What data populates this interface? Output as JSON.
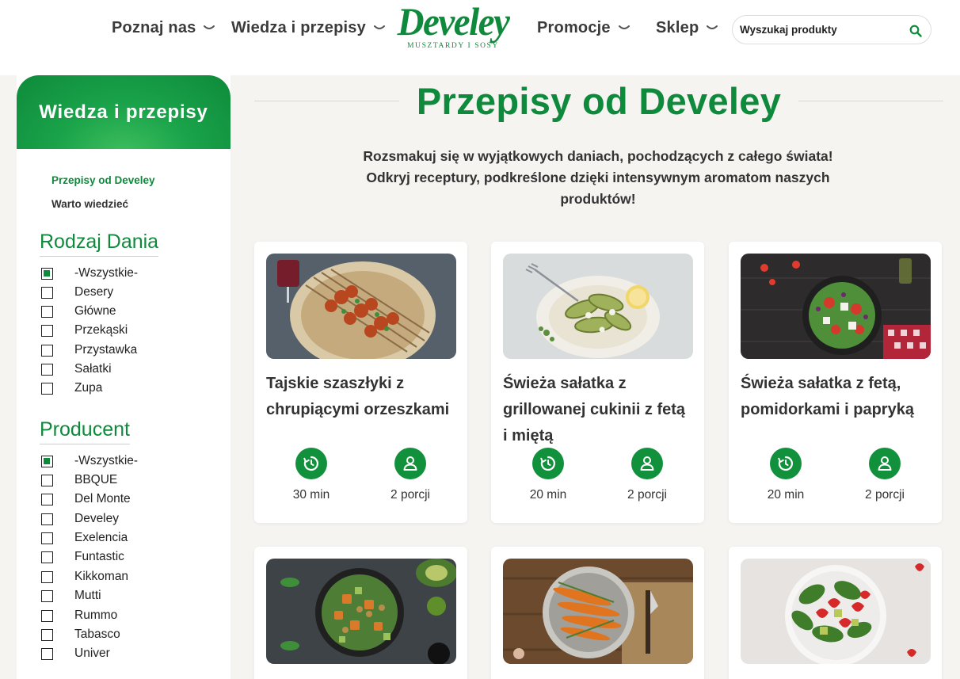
{
  "header": {
    "nav": [
      {
        "label": "Poznaj nas"
      },
      {
        "label": "Wiedza i przepisy"
      },
      {
        "label": "Promocje"
      },
      {
        "label": "Sklep"
      }
    ],
    "logo": {
      "word": "Develey",
      "tagline": "MUSZTARDY I SOSY"
    },
    "search_placeholder": "Wyszukaj produkty"
  },
  "sidebar": {
    "title": "Wiedza i przepisy",
    "links": [
      {
        "label": "Przepisy od Develey",
        "active": true
      },
      {
        "label": "Warto wiedzieć",
        "active": false
      }
    ],
    "filters": [
      {
        "title": "Rodzaj Dania",
        "options": [
          {
            "label": "-Wszystkie-",
            "checked": true
          },
          {
            "label": "Desery",
            "checked": false
          },
          {
            "label": "Główne",
            "checked": false
          },
          {
            "label": "Przekąski",
            "checked": false
          },
          {
            "label": "Przystawka",
            "checked": false
          },
          {
            "label": "Sałatki",
            "checked": false
          },
          {
            "label": "Zupa",
            "checked": false
          }
        ]
      },
      {
        "title": "Producent",
        "options": [
          {
            "label": "-Wszystkie-",
            "checked": true
          },
          {
            "label": "BBQUE",
            "checked": false
          },
          {
            "label": "Del Monte",
            "checked": false
          },
          {
            "label": "Develey",
            "checked": false
          },
          {
            "label": "Exelencia",
            "checked": false
          },
          {
            "label": "Funtastic",
            "checked": false
          },
          {
            "label": "Kikkoman",
            "checked": false
          },
          {
            "label": "Mutti",
            "checked": false
          },
          {
            "label": "Rummo",
            "checked": false
          },
          {
            "label": "Tabasco",
            "checked": false
          },
          {
            "label": "Univer",
            "checked": false
          }
        ]
      }
    ]
  },
  "main": {
    "title": "Przepisy od Develey",
    "intro": "Rozsmakuj się w wyjątkowych daniach, pochodzących z całego świata! Odkryj receptury, podkreślone dzięki intensywnym aromatom naszych produktów!",
    "recipes": [
      {
        "title": "Tajskie szaszłyki z chrupiącymi orzeszkami",
        "time": "30 min",
        "portions": "2 porcji"
      },
      {
        "title": "Świeża sałatka z grillowanej cukinii z fetą i miętą",
        "time": "20 min",
        "portions": "2 porcji"
      },
      {
        "title": "Świeża sałatka z fetą, pomidorkami i papryką",
        "time": "20 min",
        "portions": "2 porcji"
      },
      {
        "title": "",
        "time": "",
        "portions": ""
      },
      {
        "title": "",
        "time": "",
        "portions": ""
      },
      {
        "title": "",
        "time": "",
        "portions": ""
      }
    ]
  },
  "colors": {
    "brand_green": "#0f8a3c",
    "icon_green": "#12913d",
    "page_bg": "#f6f4f1"
  },
  "icons": {
    "nav_chevron": "chevron-down-icon",
    "search": "search-icon",
    "time": "timer-icon",
    "portions": "person-icon"
  }
}
